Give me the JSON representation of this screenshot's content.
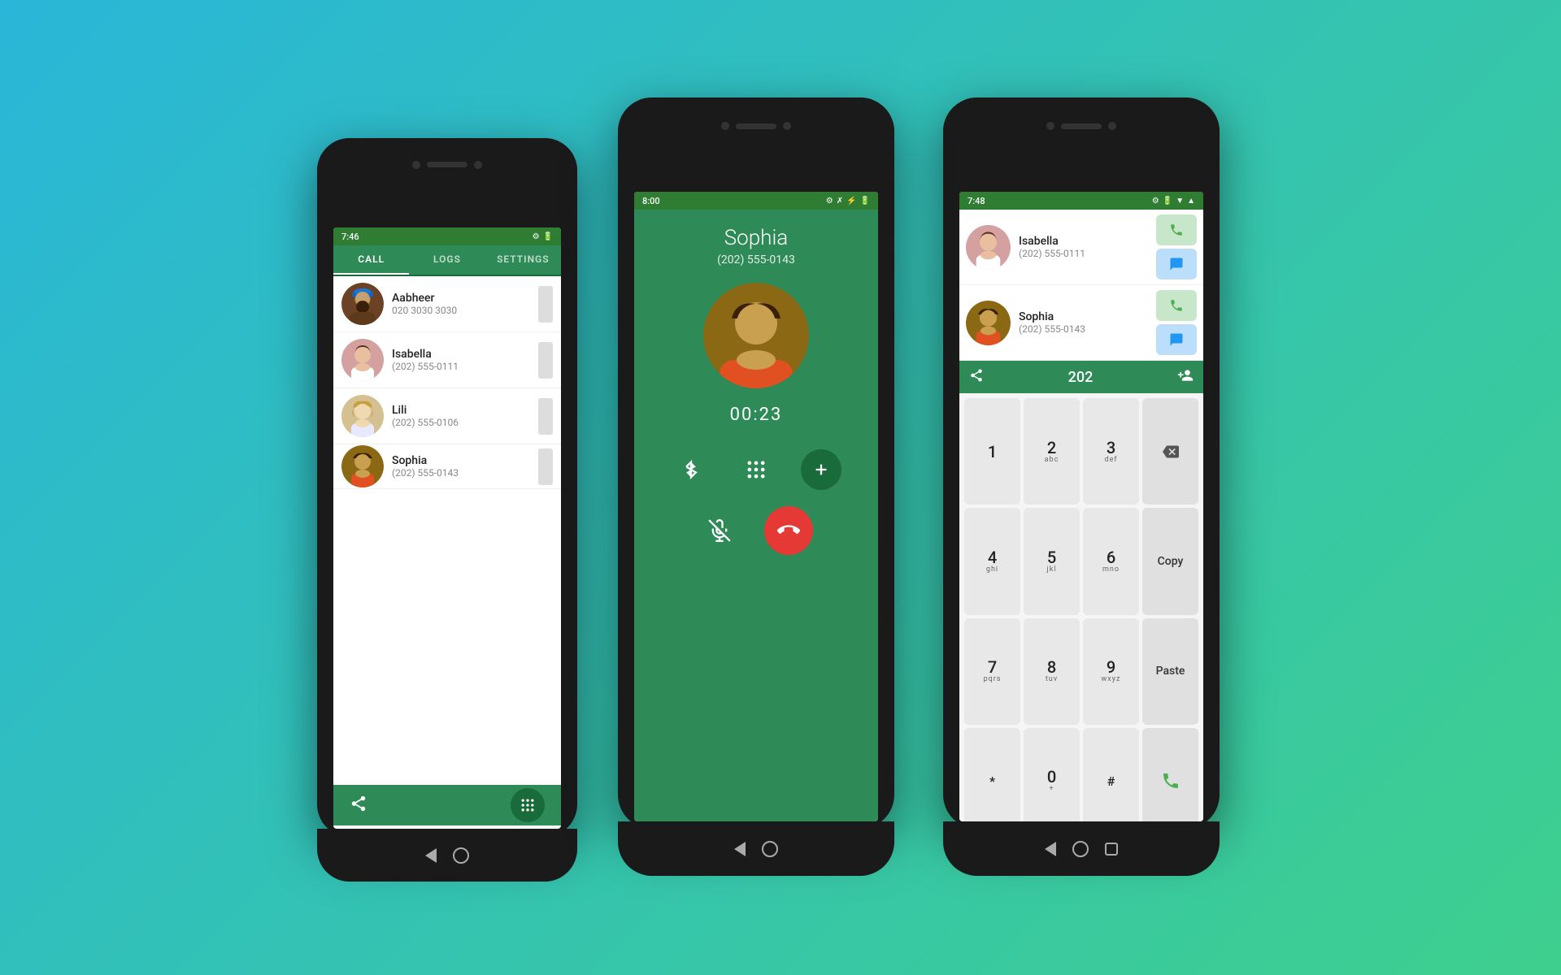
{
  "background": {
    "gradient_start": "#29b6d8",
    "gradient_end": "#3ecf8e"
  },
  "phone_left": {
    "time": "7:46",
    "tabs": {
      "call": "CALL",
      "logs": "LOGS",
      "settings": "SETTINGS"
    },
    "contacts": [
      {
        "name": "Aabheer",
        "phone": "020 3030 3030"
      },
      {
        "name": "Isabella",
        "phone": "(202) 555-0111"
      },
      {
        "name": "Lili",
        "phone": "(202) 555-0106"
      },
      {
        "name": "Sophia",
        "phone": "(202) 555-0143"
      }
    ]
  },
  "phone_center": {
    "time": "8:00",
    "caller_name": "Sophia",
    "caller_number": "(202) 555-0143",
    "call_timer": "00:23"
  },
  "phone_right": {
    "time": "7:48",
    "contacts": [
      {
        "name": "Isabella",
        "phone": "(202) 555-0111"
      },
      {
        "name": "Sophia",
        "phone": "(202) 555-0143"
      }
    ],
    "dialer_input": "202",
    "keypad": [
      {
        "num": "1",
        "sub": ""
      },
      {
        "num": "2",
        "sub": "abc"
      },
      {
        "num": "3",
        "sub": "def"
      },
      {
        "num": "4",
        "sub": "ghi"
      },
      {
        "num": "5",
        "sub": "jkl"
      },
      {
        "num": "6",
        "sub": "mno"
      },
      {
        "num": "7",
        "sub": "pqrs"
      },
      {
        "num": "8",
        "sub": "tuv"
      },
      {
        "num": "9",
        "sub": "wxyz"
      },
      {
        "num": "*",
        "sub": ""
      },
      {
        "num": "0",
        "sub": "+"
      },
      {
        "num": "#",
        "sub": ""
      }
    ],
    "copy_label": "Copy",
    "paste_label": "Paste"
  }
}
